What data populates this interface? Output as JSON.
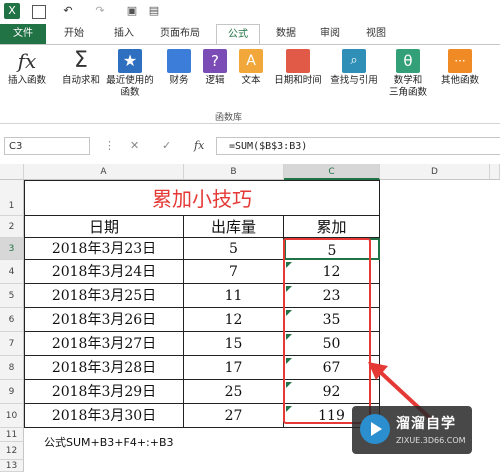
{
  "colors": {
    "brand": "#217346",
    "title_red": "#e53935",
    "highlight": "#e53935"
  },
  "qat": {
    "icons": [
      "excel-icon",
      "save-icon",
      "undo-icon",
      "redo-icon",
      "camera-icon",
      "print-preview-icon"
    ]
  },
  "tabs": {
    "file": "文件",
    "home": "开始",
    "insert": "插入",
    "layout": "页面布局",
    "formulas": "公式",
    "data": "数据",
    "review": "审阅",
    "view": "视图"
  },
  "ribbon": {
    "insert_function": "插入函数",
    "autosum": "自动求和",
    "recent_line1": "最近使用的",
    "recent_line2": "函数",
    "financial": "财务",
    "logical": "逻辑",
    "text": "文本",
    "datetime": "日期和时间",
    "lookup": "查找与引用",
    "math_line1": "数学和",
    "math_line2": "三角函数",
    "other": "其他函数",
    "group_label": "函数库"
  },
  "formula_bar": {
    "name_box": "C3",
    "formula": "=SUM($B$3:B3)"
  },
  "sheet": {
    "columns": [
      "A",
      "B",
      "C",
      "D"
    ],
    "title": "累加小技巧",
    "headers": {
      "date": "日期",
      "qty": "出库量",
      "cumulative": "累加"
    },
    "rows": [
      {
        "date": "2018年3月23日",
        "qty": "5",
        "cum": "5"
      },
      {
        "date": "2018年3月24日",
        "qty": "7",
        "cum": "12"
      },
      {
        "date": "2018年3月25日",
        "qty": "11",
        "cum": "23"
      },
      {
        "date": "2018年3月26日",
        "qty": "12",
        "cum": "35"
      },
      {
        "date": "2018年3月27日",
        "qty": "15",
        "cum": "50"
      },
      {
        "date": "2018年3月28日",
        "qty": "17",
        "cum": "67"
      },
      {
        "date": "2018年3月29日",
        "qty": "25",
        "cum": "92"
      },
      {
        "date": "2018年3月30日",
        "qty": "27",
        "cum": "119"
      }
    ],
    "row_numbers": [
      "1",
      "2",
      "3",
      "4",
      "5",
      "6",
      "7",
      "8",
      "9",
      "10",
      "11",
      "12",
      "13"
    ],
    "note": "公式SUM+B3+F4+:+B3"
  },
  "watermark": {
    "brand": "溜溜自学",
    "url": "ZIXUE.3D66.COM"
  }
}
